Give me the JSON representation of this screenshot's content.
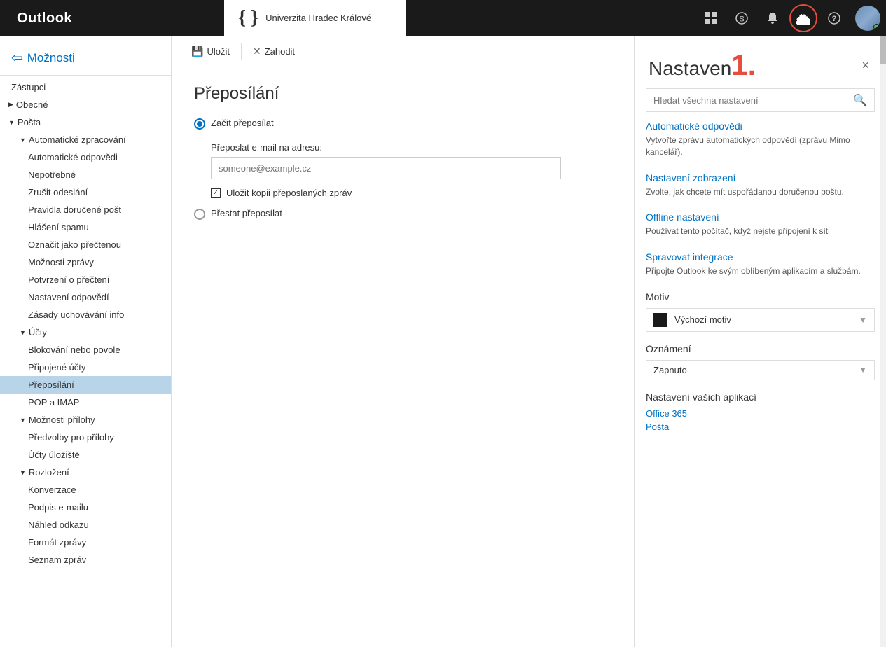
{
  "topbar": {
    "logo": "Outlook",
    "university": {
      "symbol": "{ }",
      "name": "Univerzita Hradec Králové"
    },
    "icons": {
      "grid": "⊞",
      "skype": "S",
      "bell": "🔔",
      "gear": "⚙",
      "help": "?"
    }
  },
  "sidebar": {
    "back_label": "Možnosti",
    "items": [
      {
        "id": "zastupci",
        "label": "Zástupci",
        "level": 0,
        "type": "item"
      },
      {
        "id": "obecne",
        "label": "Obecné",
        "level": 0,
        "type": "group",
        "expanded": true
      },
      {
        "id": "posta",
        "label": "Pošta",
        "level": 0,
        "type": "group",
        "expanded": true
      },
      {
        "id": "automaticke-zpracovani",
        "label": "Automatické zpracování",
        "level": 1,
        "type": "group",
        "expanded": true
      },
      {
        "id": "automaticke-odpovedi",
        "label": "Automatické odpovědi",
        "level": 2,
        "type": "item"
      },
      {
        "id": "nepotrebne",
        "label": "Nepotřebné",
        "level": 2,
        "type": "item"
      },
      {
        "id": "zrusit-odesilani",
        "label": "Zrušit odeslání",
        "level": 2,
        "type": "item"
      },
      {
        "id": "pravidla-dorucene-post",
        "label": "Pravidla doručené pošt",
        "level": 2,
        "type": "item"
      },
      {
        "id": "hlaseni-spamu",
        "label": "Hlášení spamu",
        "level": 2,
        "type": "item"
      },
      {
        "id": "oznacit-jako-precteno",
        "label": "Označit jako přečtenou",
        "level": 2,
        "type": "item"
      },
      {
        "id": "moznosti-zpravy",
        "label": "Možnosti zprávy",
        "level": 2,
        "type": "item"
      },
      {
        "id": "potvrzeni-o-precteni",
        "label": "Potvrzení o přečtení",
        "level": 2,
        "type": "item"
      },
      {
        "id": "nastaveni-odpovedi",
        "label": "Nastavení odpovědí",
        "level": 2,
        "type": "item"
      },
      {
        "id": "zasady-uchovavani-info",
        "label": "Zásady uchovávání info",
        "level": 2,
        "type": "item"
      },
      {
        "id": "ucty",
        "label": "Účty",
        "level": 1,
        "type": "group",
        "expanded": true
      },
      {
        "id": "blokovani-nebo-povole",
        "label": "Blokování nebo povole",
        "level": 2,
        "type": "item"
      },
      {
        "id": "pripojene-ucty",
        "label": "Připojené účty",
        "level": 2,
        "type": "item"
      },
      {
        "id": "preposilani",
        "label": "Přeposílání",
        "level": 2,
        "type": "item",
        "active": true
      },
      {
        "id": "pop-a-imap",
        "label": "POP a IMAP",
        "level": 2,
        "type": "item"
      },
      {
        "id": "moznosti-prilohy",
        "label": "Možnosti přílohy",
        "level": 1,
        "type": "group",
        "expanded": true
      },
      {
        "id": "predvolby-pro-prilohy",
        "label": "Předvolby pro přílohy",
        "level": 2,
        "type": "item"
      },
      {
        "id": "ucty-uloziste",
        "label": "Účty úložiště",
        "level": 2,
        "type": "item"
      },
      {
        "id": "rozlozeni",
        "label": "Rozložení",
        "level": 1,
        "type": "group",
        "expanded": true
      },
      {
        "id": "konverzace",
        "label": "Konverzace",
        "level": 2,
        "type": "item"
      },
      {
        "id": "podpis-e-mailu",
        "label": "Podpis e-mailu",
        "level": 2,
        "type": "item"
      },
      {
        "id": "nahled-odkazu",
        "label": "Náhled odkazu",
        "level": 2,
        "type": "item"
      },
      {
        "id": "format-zpravy",
        "label": "Formát zprávy",
        "level": 2,
        "type": "item"
      },
      {
        "id": "seznam-zprav",
        "label": "Seznam zpráv",
        "level": 2,
        "type": "item"
      }
    ]
  },
  "toolbar": {
    "save_label": "Uložit",
    "discard_label": "Zahodit"
  },
  "main": {
    "page_title": "Přeposílání",
    "radio_start": "Začít přeposílat",
    "forward_to_label": "Přeposlat e-mail na adresu:",
    "forward_placeholder": "someone@example.cz",
    "save_copy_label": "Uložit kopii přeposlaných zpráv",
    "radio_stop": "Přestat přeposílat"
  },
  "panel": {
    "title_text": "Nastaven",
    "title_num": "1.",
    "close_label": "×",
    "search_placeholder": "Hledat všechna nastavení",
    "sections": [
      {
        "id": "auto-responses",
        "title": "Automatické odpovědi",
        "desc": "Vytvořte zprávu automatických odpovědí (zprávu Mimo kancelář)."
      },
      {
        "id": "display-settings",
        "title": "Nastavení zobrazení",
        "desc": "Zvolte, jak chcete mít uspořádanou doručenou poštu."
      },
      {
        "id": "offline-settings",
        "title": "Offline nastavení",
        "desc": "Používat tento počítač, když nejste připojení k síti"
      },
      {
        "id": "manage-integrations",
        "title": "Spravovat integrace",
        "desc": "Připojte Outlook ke svým oblíbeným aplikacím a službám."
      }
    ],
    "motiv": {
      "label": "Motiv",
      "color": "#1a1a1a",
      "value": "Výchozí motiv"
    },
    "oznaceni": {
      "label": "Oznámení",
      "value": "Zapnuto"
    },
    "app_settings": {
      "label": "Nastavení vašich aplikací",
      "links": [
        "Office 365",
        "Pošta"
      ]
    }
  }
}
